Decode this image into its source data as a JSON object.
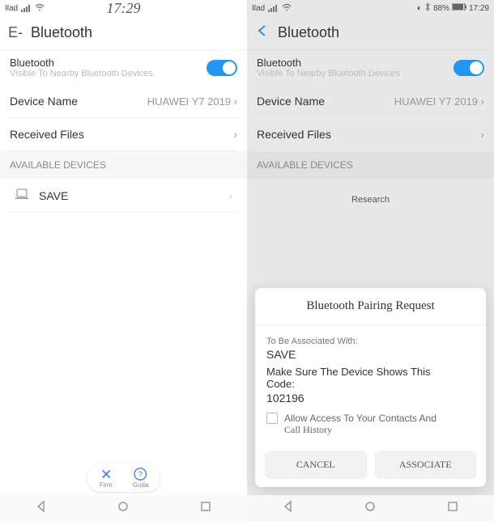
{
  "left": {
    "status": {
      "carrier": "Ilad",
      "time": "17:29"
    },
    "header": {
      "back": "E-",
      "title": "Bluetooth"
    },
    "toggle": {
      "label": "Bluetooth",
      "sub": "Visible To Nearby Bluetooth Devices"
    },
    "device_name": {
      "label": "Device Name",
      "value": "HUAWEI Y7 2019"
    },
    "received": {
      "label": "Received Files"
    },
    "section": "AVAILABLE DEVICES",
    "devices": [
      {
        "name": "SAVE"
      }
    ],
    "pill": {
      "left": "Firm",
      "right": "Guda"
    }
  },
  "right": {
    "status": {
      "carrier": "Ilad",
      "battery": "88%",
      "time": "17:29"
    },
    "header": {
      "title": "Bluetooth"
    },
    "toggle": {
      "label": "Bluetooth",
      "sub": "Visible To Nearby Bluetooth Devices"
    },
    "device_name": {
      "label": "Device Name",
      "value": "HUAWEI Y7 2019"
    },
    "received": {
      "label": "Received Files"
    },
    "section": "AVAILABLE DEVICES",
    "searching": "Research",
    "dialog": {
      "title": "Bluetooth Pairing Request",
      "assoc_label": "To Be Associated With:",
      "assoc_value": "SAVE",
      "msg1": "Make Sure The Device Shows This",
      "msg2": "Code:",
      "code": "102196",
      "checkbox": "Allow Access To Your Contacts And",
      "checkbox2": "Call History",
      "cancel": "CANCEL",
      "associate": "ASSOCIATE"
    }
  }
}
